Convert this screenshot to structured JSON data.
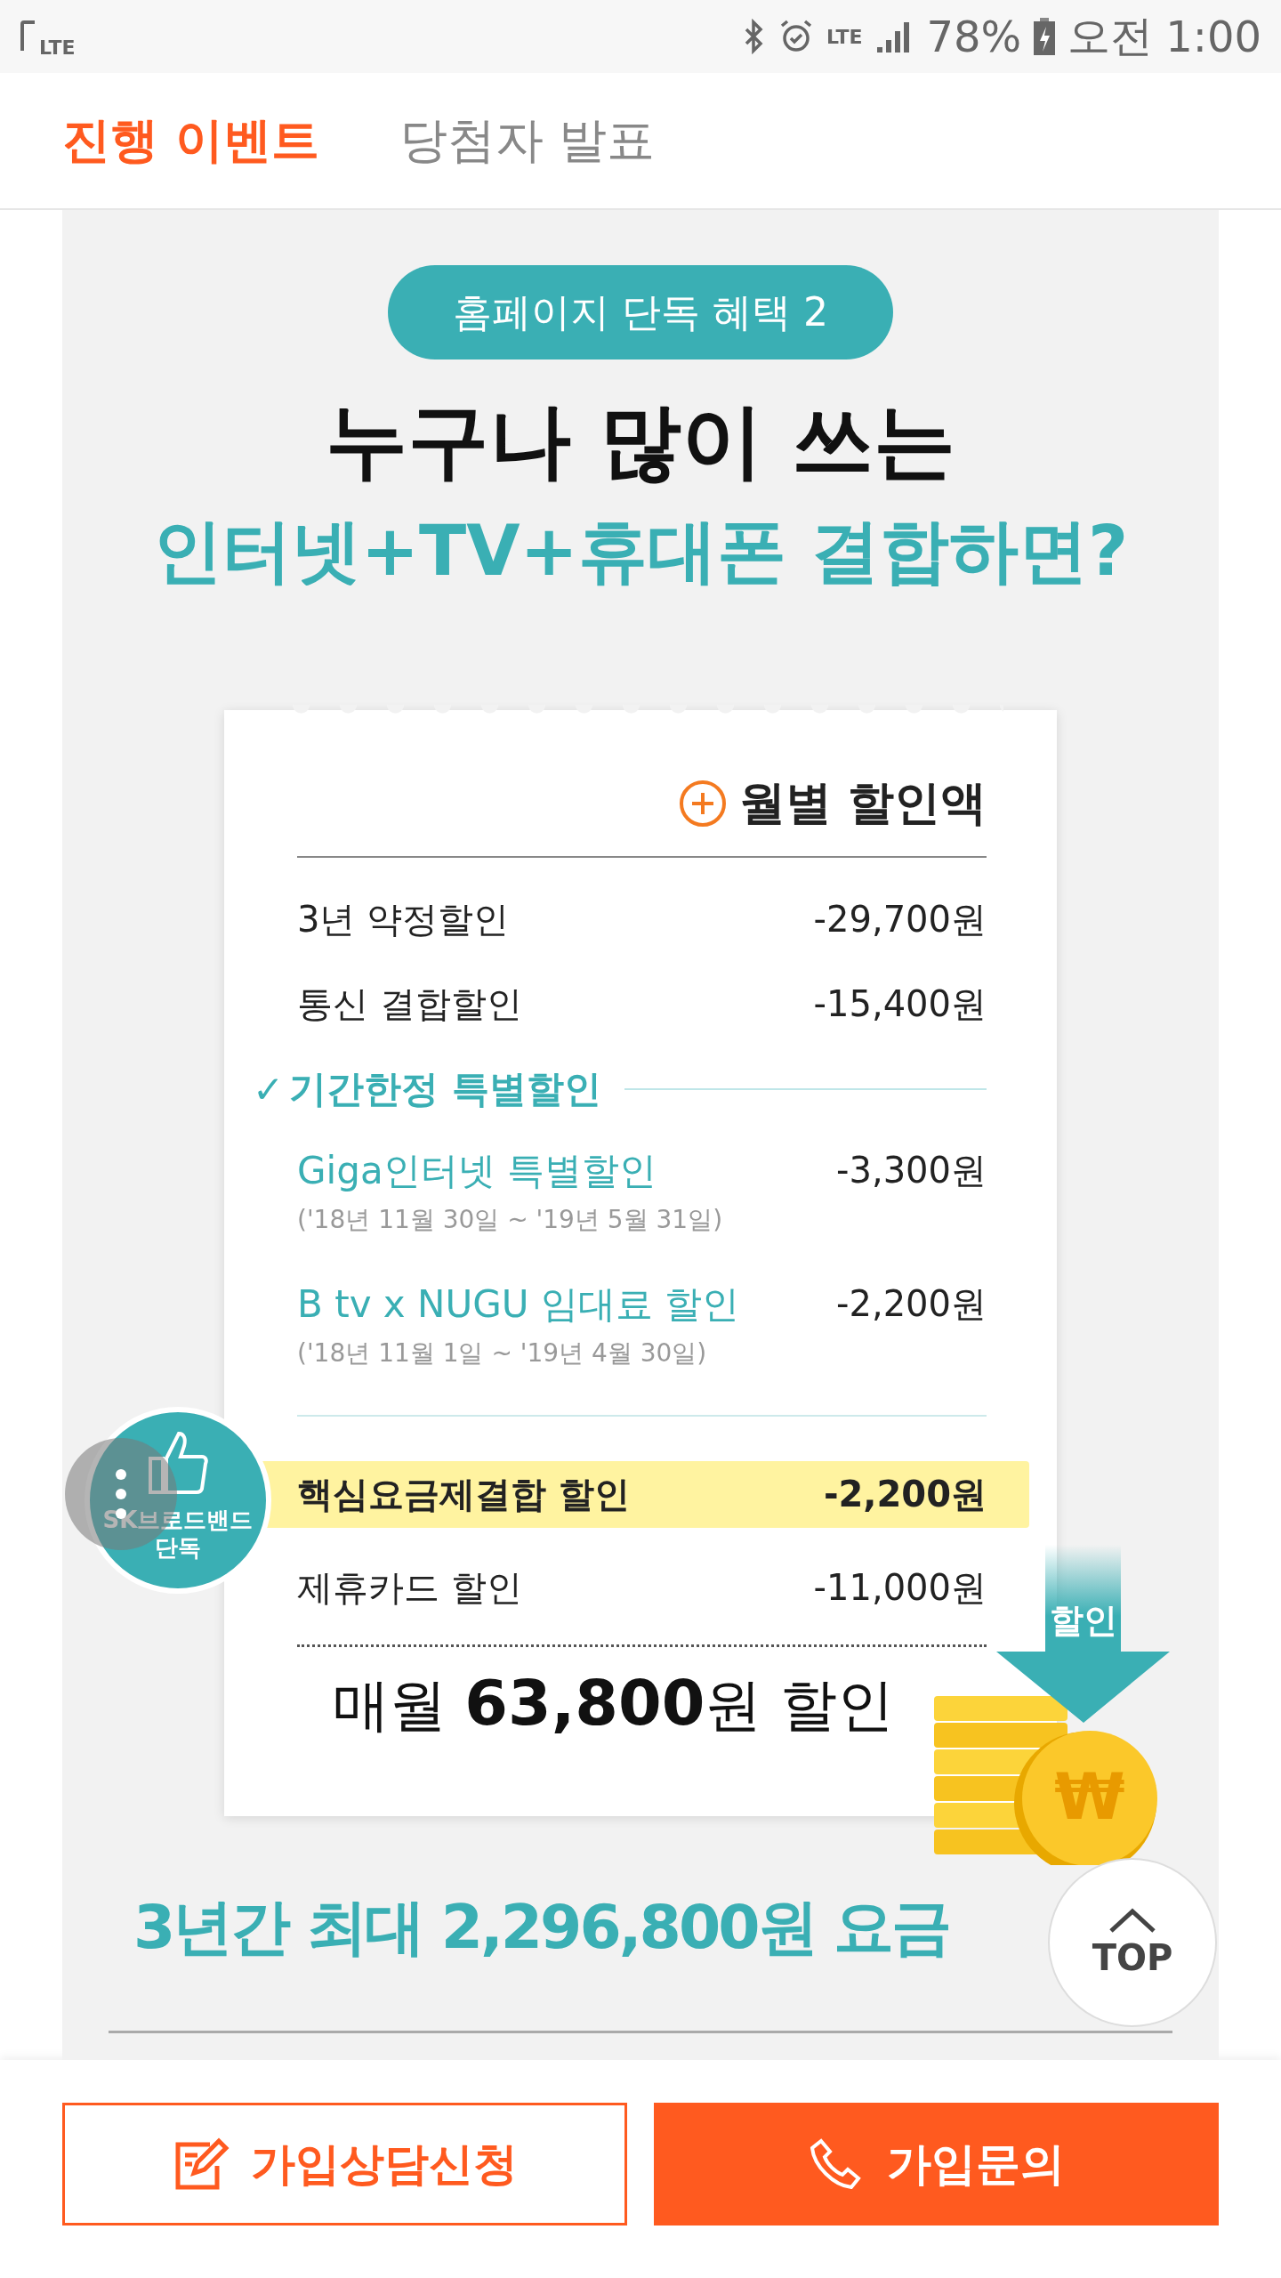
{
  "status_bar": {
    "device_label": "LTE",
    "network_label": "LTE",
    "battery": "78%",
    "ampm": "오전",
    "time": "1:00"
  },
  "tabs": [
    {
      "label": "진행 이벤트",
      "selected": true
    },
    {
      "label": "당첨자 발표",
      "selected": false
    }
  ],
  "banner": {
    "pill": "홈페이지 단독 혜택 2",
    "headline": "누구나 많이 쓰는",
    "subheadline": "인터넷+TV+휴대폰 결합하면?",
    "receipt": {
      "title": "월별 할인액",
      "rows": [
        {
          "kind": "item",
          "label": "3년 약정할인",
          "amount": "-29,700원"
        },
        {
          "kind": "item",
          "label": "통신 결합할인",
          "amount": "-15,400원"
        },
        {
          "kind": "section",
          "mark": "✓",
          "label": "기간한정 특별할인"
        },
        {
          "kind": "special",
          "label": "Giga인터넷 특별할인",
          "amount": "-3,300원",
          "period": "('18년 11월 30일 ~ '19년 5월 31일)"
        },
        {
          "kind": "special",
          "label": "B tv x NUGU 임대료 할인",
          "amount": "-2,200원",
          "period": "('18년 11월 1일 ~ '19년 4월 30일)"
        },
        {
          "kind": "highlight",
          "label": "핵심요금제결합 할인",
          "amount": "-2,200원"
        },
        {
          "kind": "item",
          "label": "제휴카드 할인",
          "amount": "-11,000원"
        }
      ],
      "total": "매월 **63,800**원 할인"
    },
    "badge": {
      "line_1": "SK브로드밴드",
      "line_2": "단독"
    },
    "arrow_label": "할인",
    "coin_symbol": "₩",
    "footer": "3년간 최대 2,296,800원 요금"
  },
  "top_button": "TOP",
  "actions": [
    {
      "kind": "outline",
      "label": "가입상담신청"
    },
    {
      "kind": "filled",
      "label": "가입문의"
    }
  ]
}
